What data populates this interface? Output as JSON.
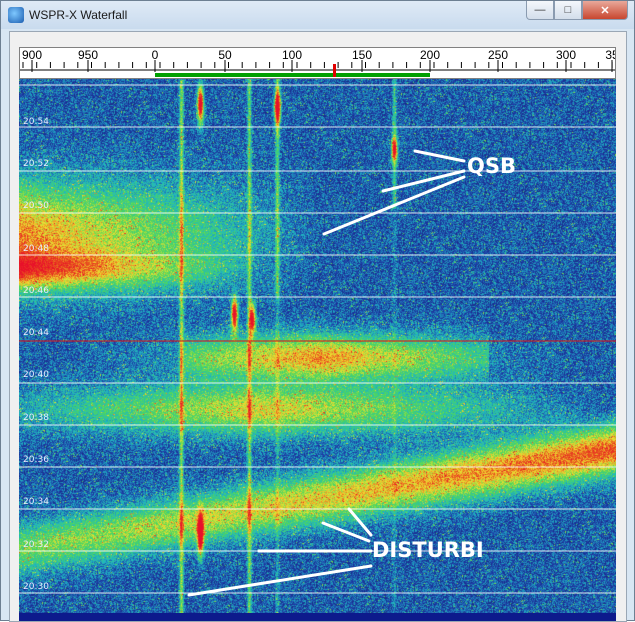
{
  "window": {
    "title": "WSPR-X Waterfall",
    "icon": "globe-icon"
  },
  "title_buttons": [
    "minimize",
    "maximize",
    "close"
  ],
  "scale": {
    "labels": [
      "900",
      "950",
      "0",
      "50",
      "100",
      "150",
      "200",
      "250",
      "300",
      "35"
    ],
    "marker_color": "#e00000",
    "band_color": "#00a000"
  },
  "waterfall": {
    "time_labels": [
      "20:54",
      "20:52",
      "20:50",
      "20:48",
      "20:46",
      "20:44",
      "20:40",
      "20:38",
      "20:36",
      "20:34",
      "20:32",
      "20:30"
    ],
    "palette": [
      "#10154a",
      "#1e3aa8",
      "#1fb6c4",
      "#4fd85a",
      "#f0e030",
      "#e8501e",
      "#e8102a"
    ]
  },
  "annotations": {
    "qsb": "QSB",
    "disturbi": "DISTURBI"
  }
}
